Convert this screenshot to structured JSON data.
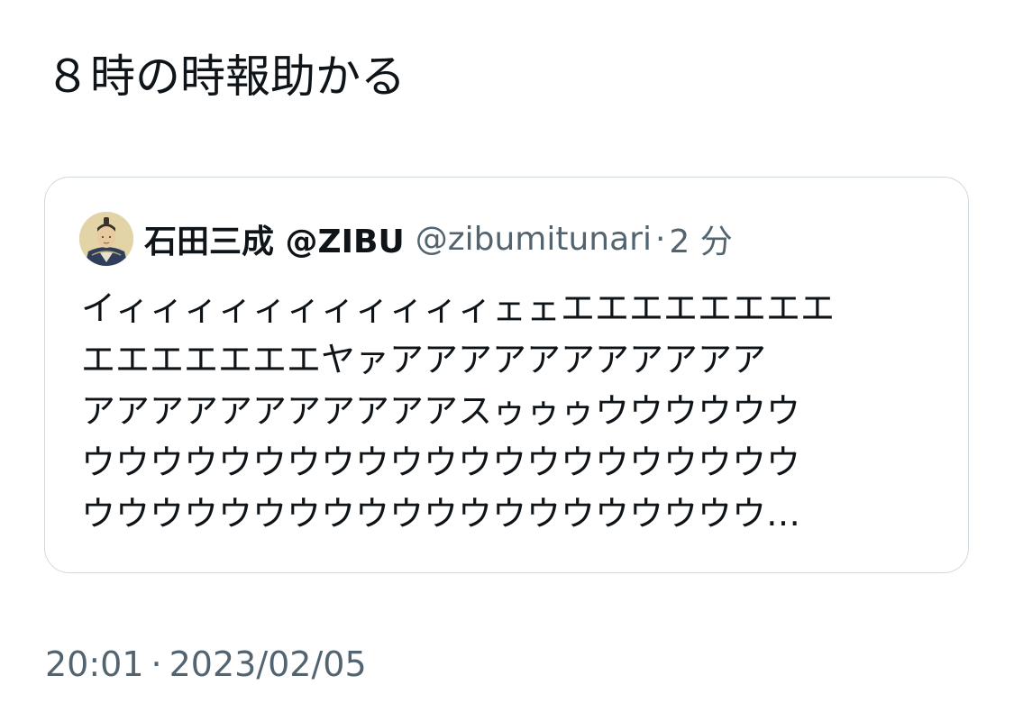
{
  "tweet": {
    "text": "８時の時報助かる",
    "timestamp_time": "20:01",
    "timestamp_separator": "·",
    "timestamp_date": "2023/02/05"
  },
  "quoted_tweet": {
    "avatar_icon": "samurai-portrait-avatar",
    "display_name": "石田三成 @ZIBU",
    "handle": "@zibumitunari",
    "separator": "·",
    "time_ago": "2 分",
    "body_lines": [
      "イィィィィィィィィィィィェェエエエエエエエエ",
      "エエエエエエエヤァアアアアアアアアアアア",
      "アアアアアアアアアアアスゥゥゥウウウウウウ",
      "ウウウウウウウウウウウウウウウウウウウウウ",
      "ウウウウウウウウウウウウウウウウウウウウ…"
    ]
  },
  "colors": {
    "text_primary": "#0f1419",
    "text_secondary": "#536471",
    "border": "#cfd9de",
    "background": "#ffffff"
  }
}
